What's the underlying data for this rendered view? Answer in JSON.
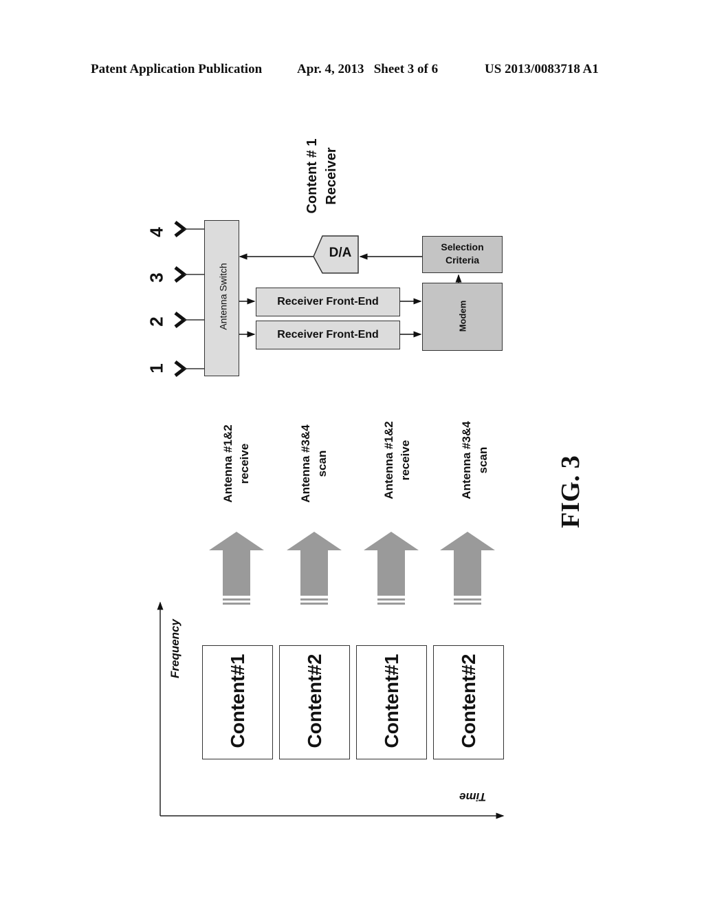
{
  "header": {
    "publication": "Patent Application Publication",
    "date_sheet": "Apr. 4, 2013   Sheet 3 of 6",
    "patent_number": "US 2013/0083718 A1"
  },
  "block_diagram": {
    "antennas": [
      "1",
      "2",
      "3",
      "4"
    ],
    "antenna_switch": "Antenna Switch",
    "receiver_front_ends": [
      "Receiver Front-End",
      "Receiver Front-End"
    ],
    "da_converter": "D/A",
    "modem": "Modem",
    "selection_criteria": [
      "Selection",
      "Criteria"
    ],
    "output_label": [
      "Content # 1",
      "Receiver"
    ]
  },
  "phases": [
    {
      "line1": "Antenna #1&2",
      "line2": "receive"
    },
    {
      "line1": "Antenna #3&4",
      "line2": "scan"
    },
    {
      "line1": "Antenna #1&2",
      "line2": "receive"
    },
    {
      "line1": "Antenna #3&4",
      "line2": "scan"
    }
  ],
  "timeline": {
    "y_axis_label": "Frequency",
    "x_axis_label": "Time",
    "slots": [
      "Content#1",
      "Content#2",
      "Content#1",
      "Content#2"
    ]
  },
  "figure_label": "FIG. 3"
}
